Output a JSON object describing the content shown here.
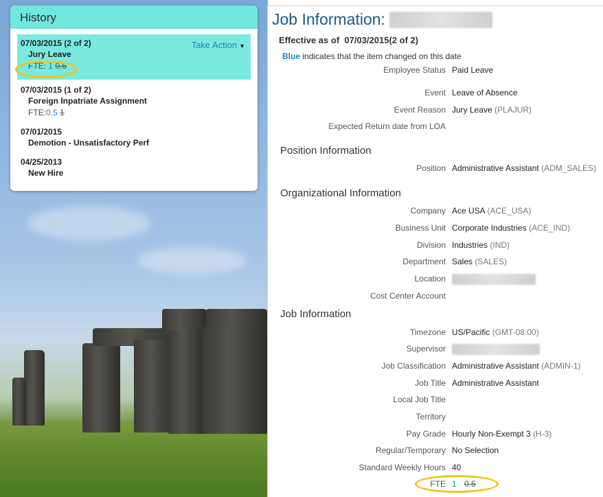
{
  "history": {
    "title": "History",
    "take_action_label": "Take Action",
    "items": [
      {
        "date": "07/03/2015 (2 of 2)",
        "event": "Jury Leave",
        "fte_label": "FTE:",
        "fte_new": "1",
        "fte_old": "0.5"
      },
      {
        "date": "07/03/2015 (1 of 2)",
        "event": "Foreign Inpatriate Assignment",
        "fte_label": "FTE:",
        "fte_new": "0.5",
        "fte_old": "1"
      },
      {
        "date": "07/01/2015",
        "event": "Demotion - Unsatisfactory Perf"
      },
      {
        "date": "04/25/2013",
        "event": "New Hire"
      }
    ]
  },
  "job": {
    "title": "Job Information:",
    "effective_label": "Effective as of",
    "effective_date": "07/03/2015(2 of 2)",
    "legend_blue": "Blue",
    "legend_text": "indicates that the item changed on this date",
    "top_fields": [
      {
        "label": "Employee Status",
        "value": "Paid Leave",
        "code": ""
      },
      {
        "label": "Event",
        "value": "Leave of Absence",
        "code": ""
      },
      {
        "label": "Event Reason",
        "value": "Jury Leave",
        "code": "(PLAJUR)"
      },
      {
        "label": "Expected Return date from LOA",
        "value": "",
        "code": ""
      }
    ],
    "position_section": "Position Information",
    "position_fields": [
      {
        "label": "Position",
        "value": "Administrative Assistant",
        "code": "(ADM_SALES)"
      }
    ],
    "org_section": "Organizational Information",
    "org_fields": [
      {
        "label": "Company",
        "value": "Ace USA",
        "code": "(ACE_USA)"
      },
      {
        "label": "Business Unit",
        "value": "Corporate Industries",
        "code": "(ACE_IND)"
      },
      {
        "label": "Division",
        "value": "Industries",
        "code": "(IND)"
      },
      {
        "label": "Department",
        "value": "Sales",
        "code": "(SALES)"
      },
      {
        "label": "Location",
        "value": "",
        "code": ""
      },
      {
        "label": "Cost Center Account",
        "value": "",
        "code": ""
      }
    ],
    "job_section": "Job Information",
    "job_fields": [
      {
        "label": "Timezone",
        "value": "US/Pacific",
        "code": "(GMT-08:00)"
      },
      {
        "label": "Supervisor",
        "value": "",
        "code": ""
      },
      {
        "label": "Job Classification",
        "value": "Administrative Assistant",
        "code": "(ADMIN-1)"
      },
      {
        "label": "Job Title",
        "value": "Administrative Assistant",
        "code": ""
      },
      {
        "label": "Local Job Title",
        "value": "",
        "code": ""
      },
      {
        "label": "Territory",
        "value": "",
        "code": ""
      },
      {
        "label": "Pay Grade",
        "value": "Hourly Non-Exempt 3",
        "code": "(H-3)"
      },
      {
        "label": "Regular/Temporary",
        "value": "No Selection",
        "code": ""
      },
      {
        "label": "Standard Weekly Hours",
        "value": "40",
        "code": ""
      }
    ],
    "fte": {
      "label": "FTE",
      "new": "1",
      "old": "0.5"
    }
  },
  "colors": {
    "header_teal": "#6fe7df",
    "selected_teal": "#7ae9e0",
    "link_blue": "#1f7fb8",
    "title_blue": "#1c5a8c",
    "highlight_yellow": "#f3c41a"
  }
}
